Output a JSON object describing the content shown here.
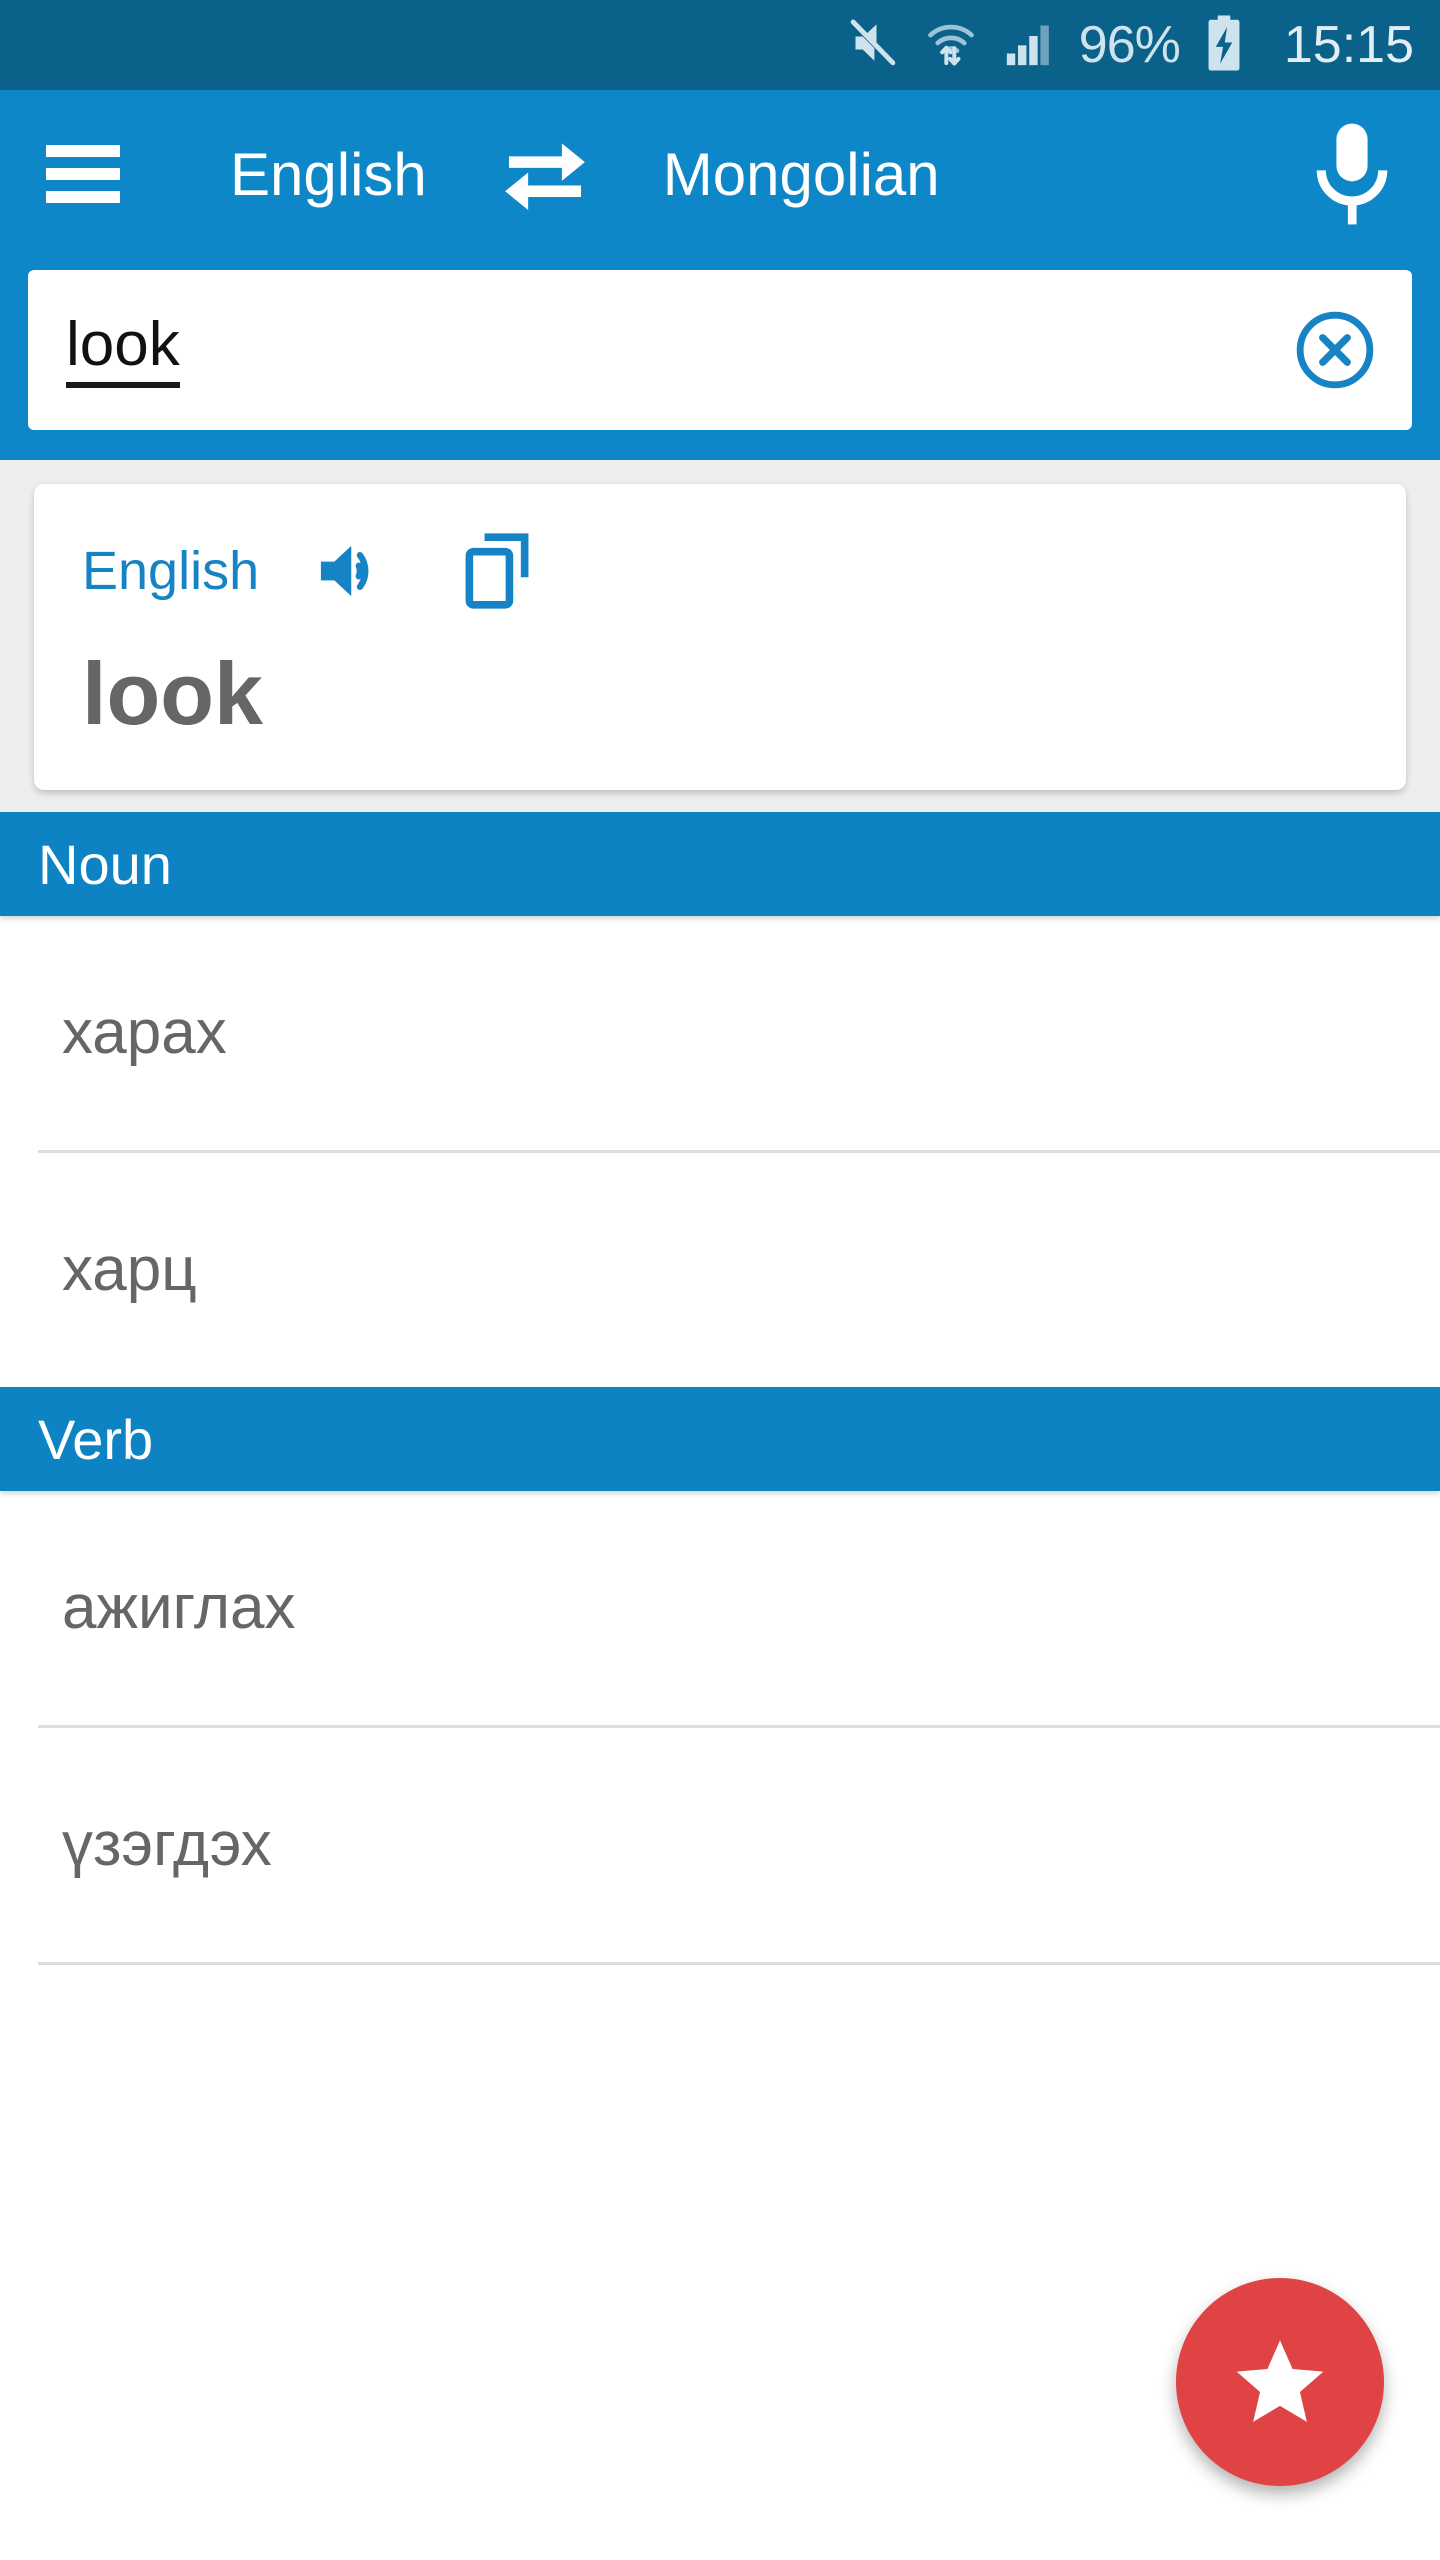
{
  "status_bar": {
    "battery_percent": "96%",
    "time": "15:15",
    "icons": [
      "mute-icon",
      "wifi-icon",
      "signal-icon",
      "battery-charging-icon"
    ],
    "background_color": "#0a6189",
    "text_color": "#cfe3ee"
  },
  "app_bar": {
    "menu_icon": "hamburger-menu-icon",
    "source_language": "English",
    "swap_icon": "swap-horizontal-icon",
    "target_language": "Mongolian",
    "mic_icon": "microphone-icon",
    "background_color": "#0e87c8"
  },
  "search": {
    "value": "look",
    "placeholder": "",
    "clear_icon": "clear-circle-icon"
  },
  "headword_card": {
    "language": "English",
    "speak_icon": "speaker-icon",
    "copy_icon": "copy-icon",
    "word": "look",
    "accent_color": "#1583c4",
    "word_color": "#666666"
  },
  "sections": [
    {
      "title": "Noun",
      "entries": [
        "харах",
        "харц"
      ]
    },
    {
      "title": "Verb",
      "entries": [
        "ажиглах",
        "үзэгдэх"
      ]
    }
  ],
  "fab": {
    "icon": "star-icon",
    "color": "#e04344"
  }
}
